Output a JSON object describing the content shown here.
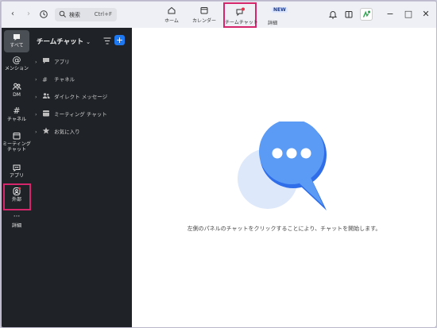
{
  "topbar": {
    "search_placeholder": "検索",
    "search_shortcut": "Ctrl+F",
    "tabs": [
      {
        "label": "ホーム",
        "icon": "home-icon"
      },
      {
        "label": "カレンダー",
        "icon": "calendar-icon"
      },
      {
        "label": "チームチャット",
        "icon": "chat-icon",
        "active": true
      },
      {
        "label": "詳細",
        "icon": "more-icon"
      }
    ],
    "new_badge": "NEW",
    "highlight_color": "#d6266b"
  },
  "rail": {
    "items": [
      {
        "label": "すべて",
        "icon": "chat-bubble-icon"
      },
      {
        "label": "メンション",
        "icon": "at-icon"
      },
      {
        "label": "DM",
        "icon": "people-icon"
      },
      {
        "label": "チャネル",
        "icon": "hash-icon"
      },
      {
        "label": "ミーティング\nチャット",
        "icon": "calendar-icon"
      },
      {
        "label": "アプリ",
        "icon": "apps-icon"
      },
      {
        "label": "外部",
        "icon": "external-user-icon"
      },
      {
        "label": "詳細",
        "icon": "ellipsis-icon"
      }
    ]
  },
  "panel": {
    "title": "チームチャット",
    "accent": "#1e78f0",
    "tree": [
      {
        "label": "アプリ",
        "icon": "apps-icon"
      },
      {
        "label": "チャネル",
        "icon": "hash-icon"
      },
      {
        "label": "ダイレクト メッセージ",
        "icon": "people-icon"
      },
      {
        "label": "ミーティング チャット",
        "icon": "calendar-icon"
      },
      {
        "label": "お気に入り",
        "icon": "star-icon"
      }
    ]
  },
  "main": {
    "empty_message": "左側のパネルのチャットをクリックすることにより、チャットを開始します。"
  }
}
